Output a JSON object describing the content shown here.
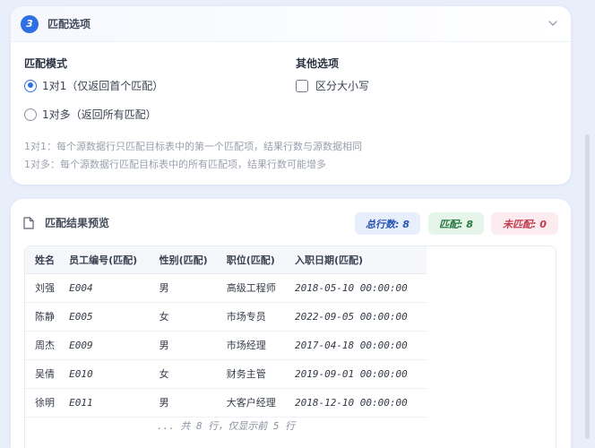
{
  "options": {
    "step_number": "3",
    "title": "匹配选项",
    "match_mode": {
      "label": "匹配模式",
      "choices": [
        {
          "label": "1对1（仅返回首个匹配）",
          "selected": true
        },
        {
          "label": "1对多（返回所有匹配）",
          "selected": false
        }
      ]
    },
    "other": {
      "label": "其他选项",
      "case_sensitive_label": "区分大小写",
      "case_sensitive_checked": false
    },
    "hints": [
      "1对1：每个源数据行只匹配目标表中的第一个匹配项，结果行数与源数据相同",
      "1对多：每个源数据行匹配目标表中的所有匹配项，结果行数可能增多"
    ]
  },
  "preview": {
    "title": "匹配结果预览",
    "badges": {
      "total": "总行数: 8",
      "matched": "匹配: 8",
      "unmatched": "未匹配: 0"
    },
    "columns": [
      "姓名",
      "员工编号(匹配)",
      "性别(匹配)",
      "职位(匹配)",
      "入职日期(匹配)"
    ],
    "rows": [
      [
        "刘强",
        "E004",
        "男",
        "高级工程师",
        "2018-05-10 00:00:00"
      ],
      [
        "陈静",
        "E005",
        "女",
        "市场专员",
        "2022-09-05 00:00:00"
      ],
      [
        "周杰",
        "E009",
        "男",
        "市场经理",
        "2017-04-18 00:00:00"
      ],
      [
        "吴倩",
        "E010",
        "女",
        "财务主管",
        "2019-09-01 00:00:00"
      ],
      [
        "徐明",
        "E011",
        "男",
        "大客户经理",
        "2018-12-10 00:00:00"
      ]
    ],
    "footer": "... 共 8 行，仅显示前 5 行"
  },
  "colors": {
    "accent": "#2f6fe4",
    "page_bg": "#e9eefb",
    "match_green": "#26783f",
    "unmatched_red": "#c43a4d"
  }
}
